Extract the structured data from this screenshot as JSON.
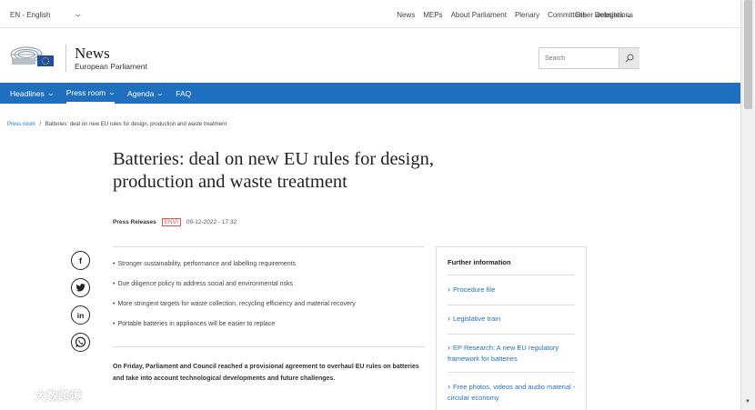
{
  "topbar": {
    "language": "EN - English",
    "links": [
      "News",
      "MEPs",
      "About Parliament",
      "Plenary",
      "Committees",
      "Delegations"
    ],
    "other_websites": "Other websites"
  },
  "header": {
    "title": "News",
    "subtitle": "European Parliament",
    "search_placeholder": "Search"
  },
  "nav": {
    "items": [
      {
        "label": "Headlines",
        "has_menu": true
      },
      {
        "label": "Press room",
        "has_menu": true,
        "active": true
      },
      {
        "label": "Agenda",
        "has_menu": true
      },
      {
        "label": "FAQ",
        "has_menu": false
      }
    ]
  },
  "breadcrumb": {
    "home": "Press room",
    "separator": "/",
    "current": "Batteries: deal on new EU rules for design, production and waste treatment"
  },
  "article": {
    "title": "Batteries: deal on new EU rules for design, production and waste treatment",
    "type": "Press Releases",
    "committee": "ENVI",
    "datetime": "09-12-2022 - 17:32",
    "bullets": [
      "Stronger sustainability, performance and labelling requirements",
      "Due diligence policy to address social and environmental risks",
      "More stringent targets for waste collection, recycling efficiency and material recovery",
      "Portable batteries in appliances will be easier to replace"
    ],
    "lead": "On Friday, Parliament and Council reached a provisional agreement to overhaul EU rules on batteries and take into account technological developments and future challenges."
  },
  "social": {
    "icons": [
      "facebook-icon",
      "twitter-icon",
      "linkedin-icon",
      "whatsapp-icon"
    ]
  },
  "further_info": {
    "title": "Further information",
    "links": [
      "Procedure file",
      "Legislative train",
      "EP Research: A new EU regulatory framework for batteries",
      "Free photos, videos and audio material - circular economy"
    ]
  },
  "watermark": {
    "text": "大数跨境"
  },
  "colors": {
    "nav_blue": "#1f6fc0",
    "link_blue": "#1f6fc0",
    "committee_red": "#d9534f"
  }
}
